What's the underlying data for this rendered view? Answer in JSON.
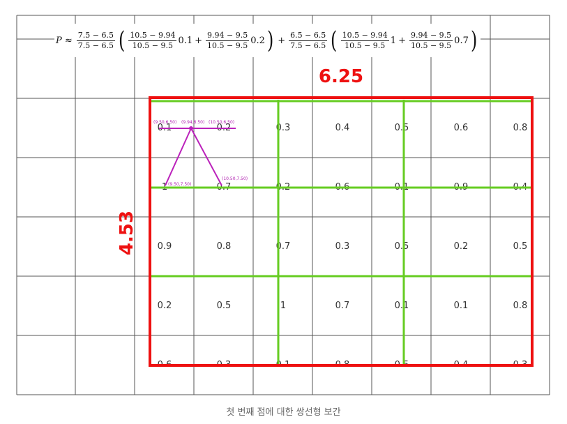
{
  "colors": {
    "grid": "#555555",
    "outer_box": "#ee1111",
    "inner_grid": "#66cc22",
    "interp_lines": "#bb22bb",
    "dimension_text": "#ee1111"
  },
  "formula": {
    "lhs": "P ≈",
    "t1_num": "7.5 − 6.5",
    "t1_den": "7.5 − 6.5",
    "a_num": "10.5 − 9.94",
    "a_den": "10.5 − 9.5",
    "a_val": "0.1",
    "b_num": "9.94 − 9.5",
    "b_den": "10.5 − 9.5",
    "b_val": "0.2",
    "t2_num": "6.5 − 6.5",
    "t2_den": "7.5 − 6.5",
    "c_num": "10.5 − 9.94",
    "c_den": "10.5 − 9.5",
    "c_val": "1",
    "d_num": "9.94 − 9.5",
    "d_den": "10.5 − 9.5",
    "d_val": "0.7"
  },
  "width_label": "6.25",
  "height_label": "4.53",
  "cells": [
    [
      "0.1",
      "0.2",
      "0.3",
      "0.4",
      "0.5",
      "0.6",
      "0.8"
    ],
    [
      "1",
      "0.7",
      "0.2",
      "0.6",
      "0.1",
      "0.9",
      "0.4"
    ],
    [
      "0.9",
      "0.8",
      "0.7",
      "0.3",
      "0.5",
      "0.2",
      "0.5"
    ],
    [
      "0.2",
      "0.5",
      "1",
      "0.7",
      "0.1",
      "0.1",
      "0.8"
    ],
    [
      "0.6",
      "0.3",
      "0.1",
      "0.8",
      "0.5",
      "0.4",
      "0.3"
    ]
  ],
  "point_labels": {
    "p_950_650": "(9.50,6.50)",
    "p_994_650": "(9.94,6.50)",
    "p_1050_650": "(10.50,6.50)",
    "p_950_750": "(9.50,7.50)",
    "p_1050_750": "(10.50,7.50)"
  },
  "caption": "첫 번째 점에 대한 쌍선형 보간"
}
